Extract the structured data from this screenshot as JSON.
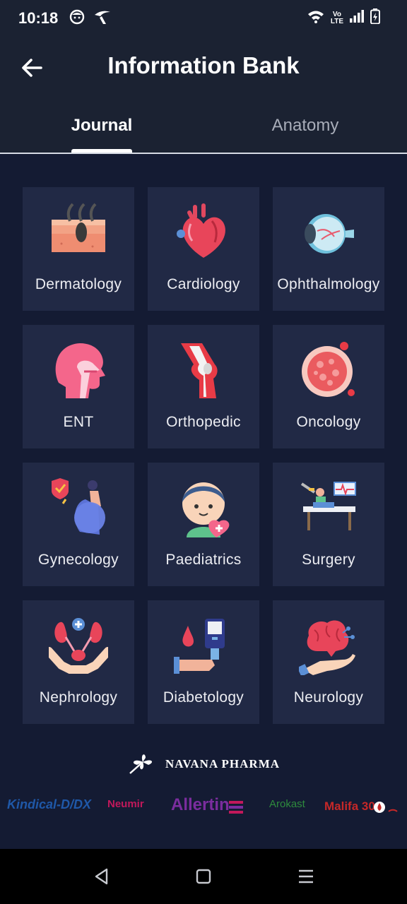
{
  "status_bar": {
    "time": "10:18",
    "network_badge": "Vo\nLTE",
    "icons": [
      "notification-face-icon",
      "carrier-logo-icon",
      "wifi-icon",
      "volte-icon",
      "signal-icon",
      "battery-charging-icon"
    ]
  },
  "header": {
    "title": "Information Bank",
    "back_icon": "arrow-left-icon"
  },
  "tabs": [
    {
      "label": "Journal",
      "active": true
    },
    {
      "label": "Anatomy",
      "active": false
    }
  ],
  "categories": [
    {
      "label": "Dermatology",
      "icon": "skin-hair-icon"
    },
    {
      "label": "Cardiology",
      "icon": "heart-icon"
    },
    {
      "label": "Ophthalmology",
      "icon": "eye-icon"
    },
    {
      "label": "ENT",
      "icon": "head-throat-icon"
    },
    {
      "label": "Orthopedic",
      "icon": "knee-bone-icon"
    },
    {
      "label": "Oncology",
      "icon": "cancer-cell-icon"
    },
    {
      "label": "Gynecology",
      "icon": "pregnant-woman-icon"
    },
    {
      "label": "Paediatrics",
      "icon": "child-icon"
    },
    {
      "label": "Surgery",
      "icon": "surgery-table-icon"
    },
    {
      "label": "Nephrology",
      "icon": "kidney-hands-icon"
    },
    {
      "label": "Diabetology",
      "icon": "glucose-meter-icon"
    },
    {
      "label": "Neurology",
      "icon": "brain-hand-icon"
    }
  ],
  "sponsor": {
    "name": "NAVANA PHARMA",
    "logo_icon": "navana-flower-logo"
  },
  "brands": [
    {
      "name": "Kindical-D/DX",
      "color": "#1f58a8"
    },
    {
      "name": "Neumir",
      "color": "#c2185b"
    },
    {
      "name": "Allertin",
      "color": "#7b2d9e"
    },
    {
      "name": "Arokast",
      "color": "#2e8b3d"
    },
    {
      "name": "Malifa 30",
      "color": "#c62828"
    }
  ],
  "nav_bar": {
    "buttons": [
      "back-triangle-icon",
      "home-square-icon",
      "menu-lines-icon"
    ]
  },
  "colors": {
    "background": "#141b33",
    "appbar": "#1b2232",
    "card": "#212945",
    "accent_pink": "#f4668b"
  }
}
